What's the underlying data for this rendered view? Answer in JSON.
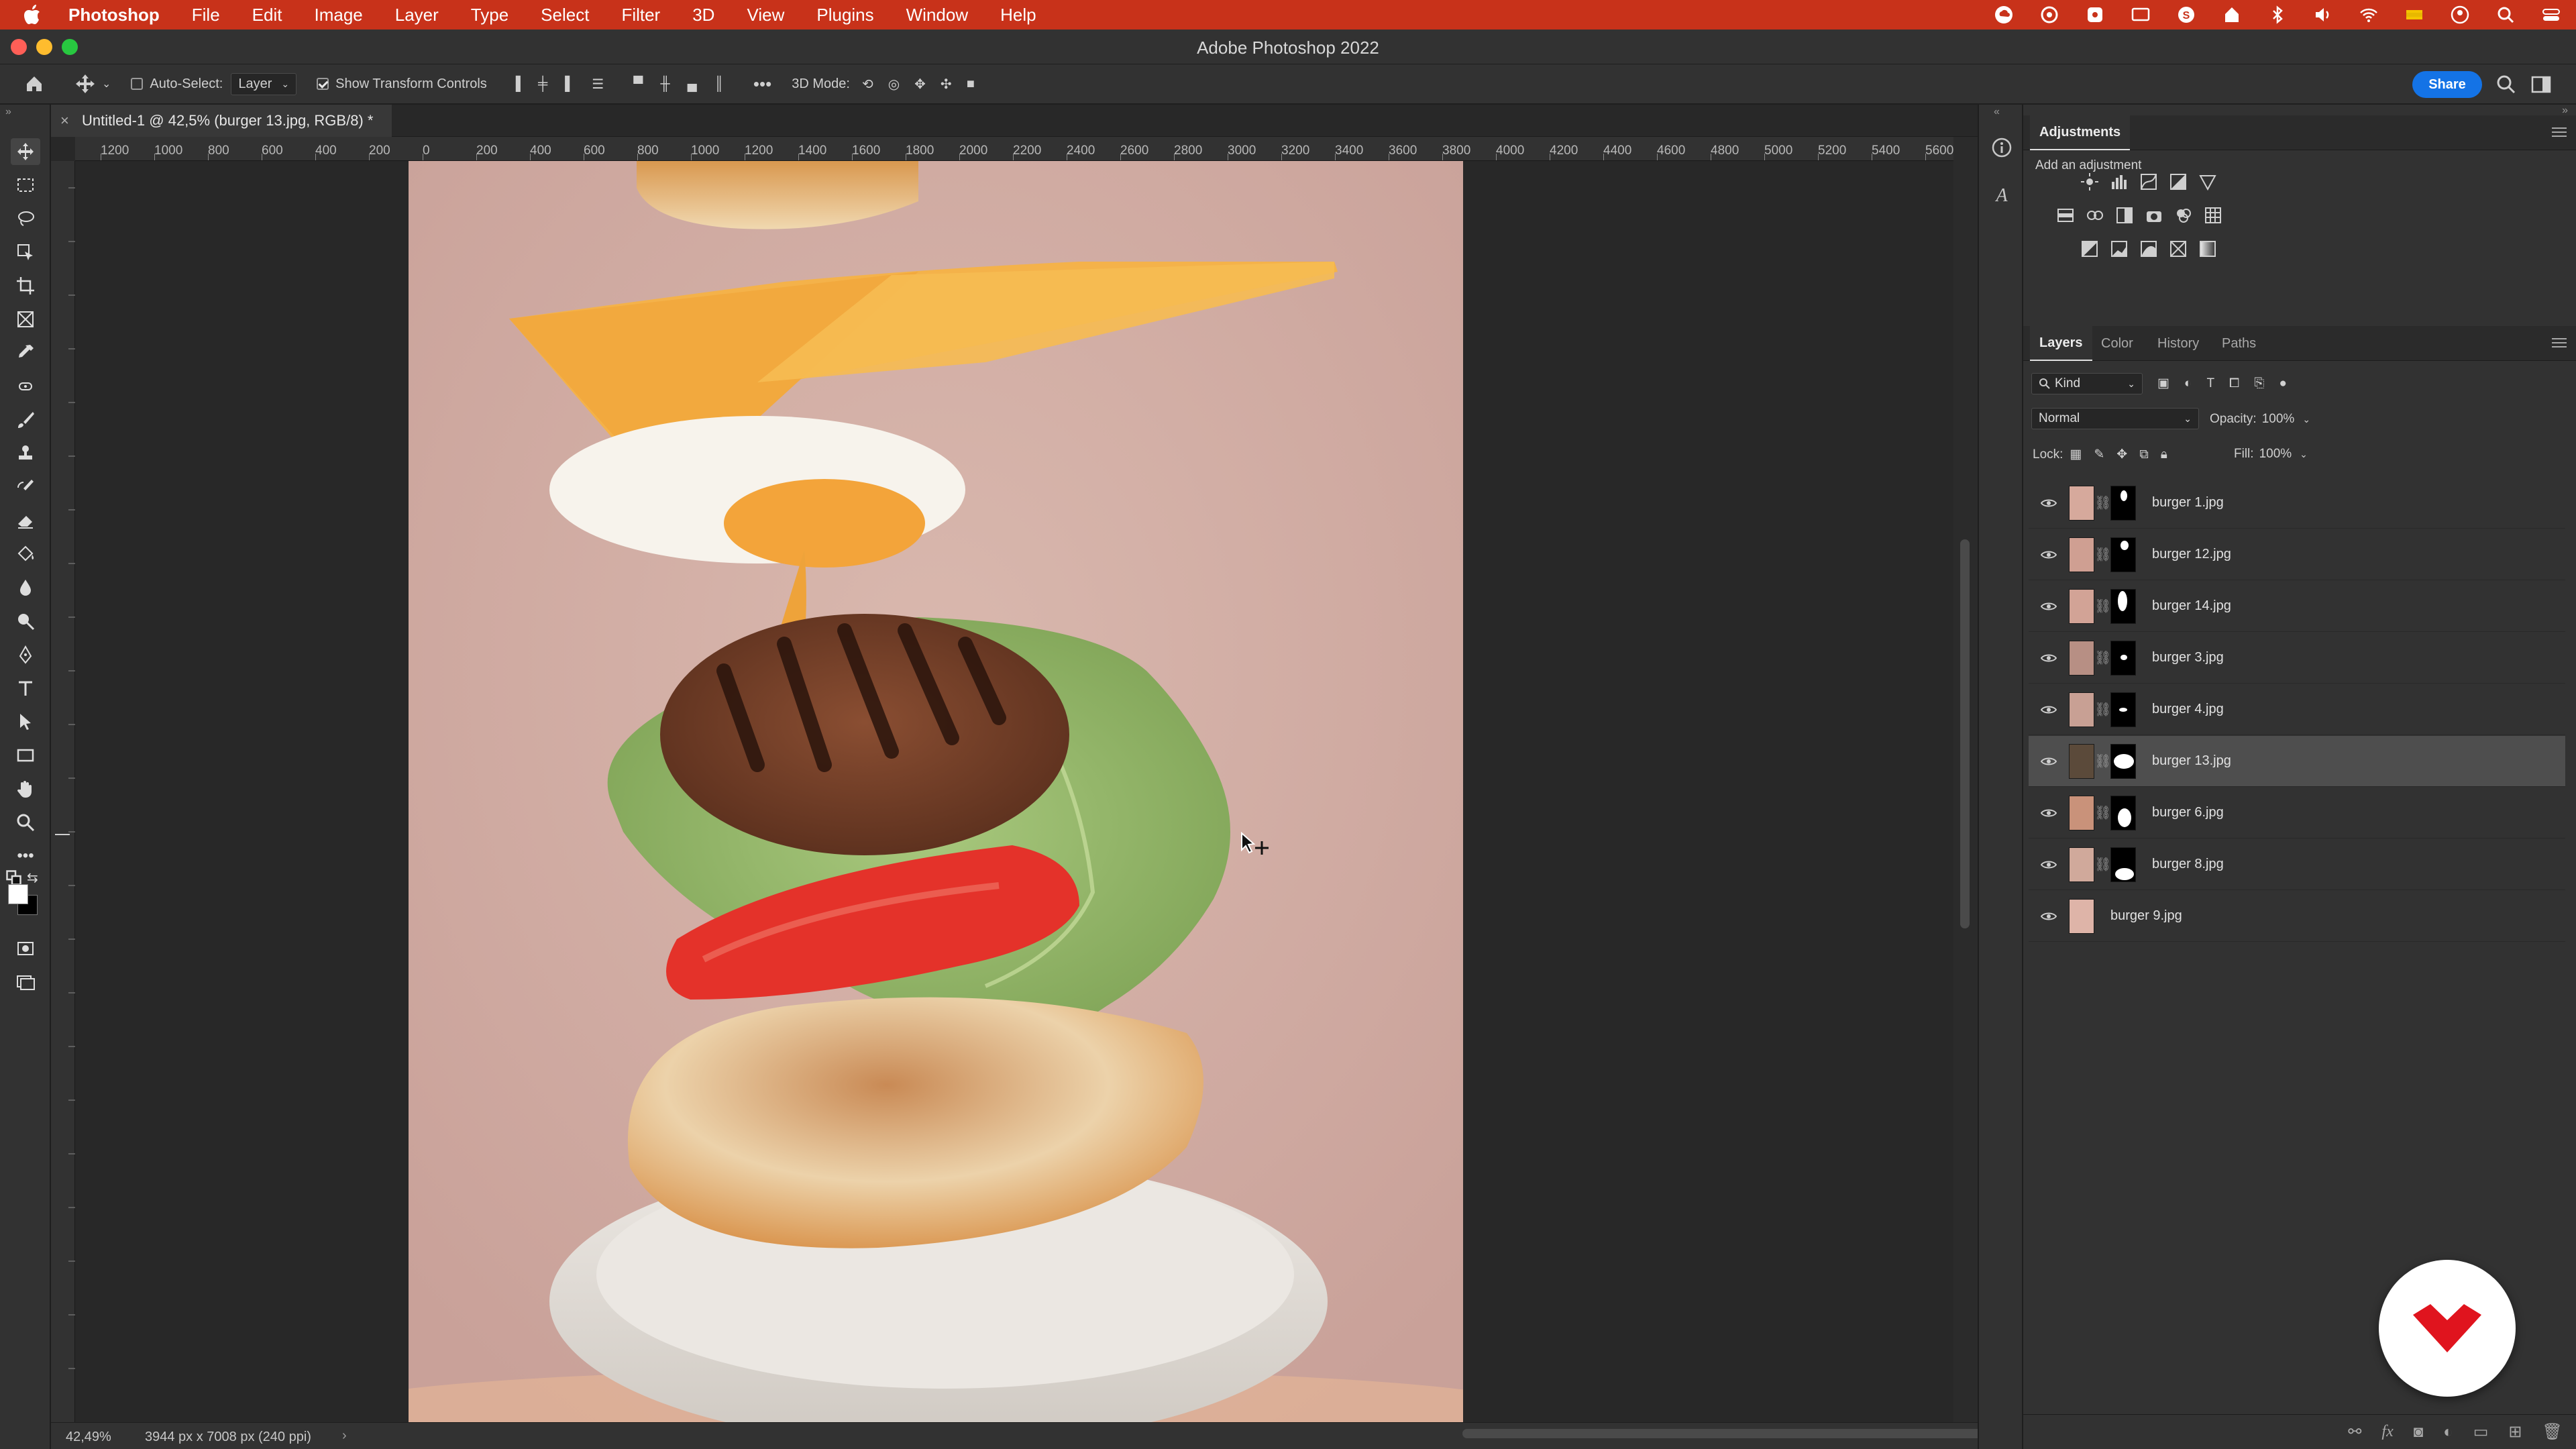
{
  "menubar": {
    "app_name": "Photoshop",
    "items": [
      "File",
      "Edit",
      "Image",
      "Layer",
      "Type",
      "Select",
      "Filter",
      "3D",
      "View",
      "Plugins",
      "Window",
      "Help"
    ],
    "status_icons": [
      "creative-cloud-icon",
      "cc-sync-icon",
      "lastpass-icon",
      "screen-icon",
      "skype-icon",
      "home-status-icon",
      "bluetooth-icon",
      "volume-icon",
      "wifi-icon",
      "flag-icon",
      "user-icon",
      "spotlight-icon",
      "control-center-icon"
    ]
  },
  "window": {
    "title": "Adobe Photoshop 2022"
  },
  "options": {
    "auto_select_label": "Auto-Select:",
    "auto_select_value": "Layer",
    "show_transform_label": "Show Transform Controls",
    "mode_3d_label": "3D Mode:",
    "share_label": "Share"
  },
  "document": {
    "tab_title": "Untitled-1 @ 42,5% (burger 13.jpg, RGB/8) *",
    "ruler_ticks": [
      "1200",
      "1000",
      "800",
      "600",
      "400",
      "200",
      "0",
      "200",
      "400",
      "600",
      "800",
      "1000",
      "1200",
      "1400",
      "1600",
      "1800",
      "2000",
      "2200",
      "2400",
      "2600",
      "2800",
      "3000",
      "3200",
      "3400",
      "3600",
      "3800",
      "4000",
      "4200",
      "4400",
      "4600",
      "4800",
      "5000",
      "5200",
      "5400",
      "5600"
    ]
  },
  "status": {
    "zoom": "42,49%",
    "doc_size": "3944 px x 7008 px (240 ppi)",
    "arrow": "›"
  },
  "adjustments": {
    "tab_label": "Adjustments",
    "add_label": "Add an adjustment",
    "rows": [
      [
        "brightness-icon",
        "levels-icon",
        "curves-icon",
        "exposure-icon",
        "vibrance-icon"
      ],
      [
        "hue-saturation-icon",
        "color-balance-icon",
        "black-white-icon",
        "photo-filter-icon",
        "channel-mixer-icon",
        "color-lookup-icon"
      ],
      [
        "invert-icon",
        "posterize-icon",
        "threshold-icon",
        "selective-color-icon",
        "gradient-map-icon"
      ]
    ]
  },
  "layers_panel": {
    "tabs": [
      "Layers",
      "Color",
      "History",
      "Paths"
    ],
    "kind_label": "Kind",
    "blend_mode": "Normal",
    "opacity_label": "Opacity:",
    "opacity_value": "100%",
    "lock_label": "Lock:",
    "fill_label": "Fill:",
    "fill_value": "100%",
    "layers": [
      {
        "name": "burger 1.jpg",
        "selected": false
      },
      {
        "name": "burger 12.jpg",
        "selected": false
      },
      {
        "name": "burger 14.jpg",
        "selected": false
      },
      {
        "name": "burger 3.jpg",
        "selected": false
      },
      {
        "name": "burger 4.jpg",
        "selected": false
      },
      {
        "name": "burger 13.jpg",
        "selected": true
      },
      {
        "name": "burger 6.jpg",
        "selected": false
      },
      {
        "name": "burger 8.jpg",
        "selected": false
      },
      {
        "name": "burger 9.jpg",
        "selected": false
      }
    ]
  },
  "colors": {
    "menubar_bg": "#c8321a",
    "accent_blue": "#1473e6",
    "brand_red": "#e0141e"
  }
}
